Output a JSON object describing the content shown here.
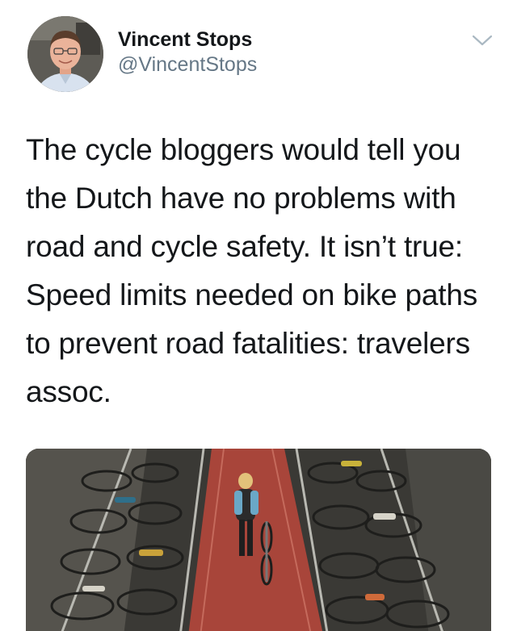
{
  "tweet": {
    "author": {
      "display_name": "Vincent Stops",
      "handle": "@VincentStops",
      "avatar_icon": "profile-photo"
    },
    "menu_icon": "chevron-down-icon",
    "text": "The cycle bloggers would tell you the Dutch have no problems with road and cycle safety. It isn’t true: Speed limits needed on bike paths to prevent road fatalities: travelers assoc.",
    "media": {
      "kind": "photo",
      "subject": "bicycle-parking-photo"
    }
  },
  "colors": {
    "text": "#14171a",
    "secondary": "#657786",
    "caret": "#aab8c2",
    "path": "#a8453a"
  }
}
